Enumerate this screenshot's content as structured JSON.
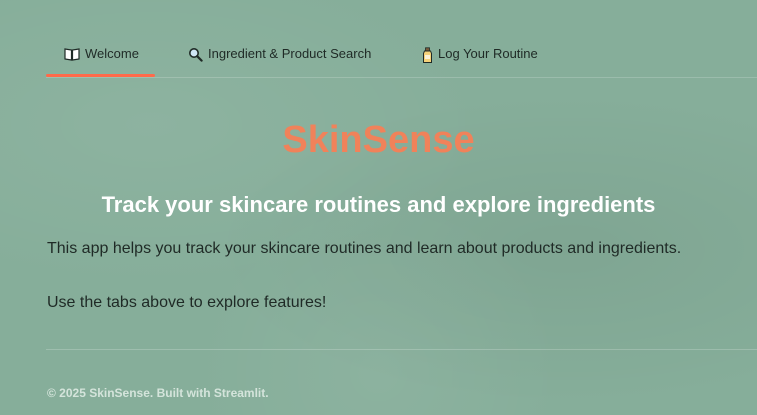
{
  "tabs": [
    {
      "icon": "open-book-icon",
      "label": "Welcome",
      "active": true
    },
    {
      "icon": "magnifier-icon",
      "label": "Ingredient & Product Search",
      "active": false
    },
    {
      "icon": "bottle-icon",
      "label": "Log Your Routine",
      "active": false
    }
  ],
  "main": {
    "title": "SkinSense",
    "subtitle": "Track your skincare routines and explore ingredients",
    "paragraph_1": "This app helps you track your skincare routines and learn about products and ingredients.",
    "paragraph_2": "Use the tabs above to explore features!"
  },
  "footer": {
    "text": "© 2025 SkinSense. Built with Streamlit."
  },
  "colors": {
    "background": "#86ae9a",
    "accent": "#ff6a4a",
    "title": "#f0825a",
    "subtitle": "#ffffff"
  }
}
